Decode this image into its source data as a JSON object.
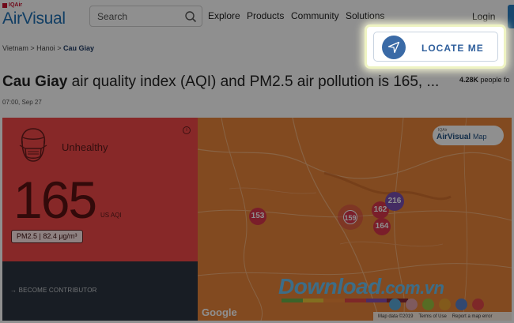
{
  "header": {
    "brand_top": "IQAir",
    "brand_main": "AirVisual",
    "search_placeholder": "Search",
    "nav": [
      "Explore",
      "Products",
      "Community",
      "Solutions"
    ],
    "login_label": "Login"
  },
  "breadcrumb": {
    "items": [
      "Vietnam",
      "Hanoi",
      "Cau Giay"
    ],
    "separator": ">"
  },
  "title": {
    "city": "Cau Giay",
    "rest": " air quality index (AQI) and PM2.5 air pollution is 165, ..."
  },
  "timestamp": "07:00, Sep 27",
  "followers": {
    "count": "4.28K",
    "suffix": " people fo"
  },
  "locate_button": {
    "label": "LOCATE ME",
    "icon": "navigation-arrow-icon"
  },
  "aqi": {
    "status": "Unhealthy",
    "value": "165",
    "unit": "US AQI",
    "pm25": "PM2.5 | 82.4 µg/m³",
    "info": "i"
  },
  "contributor": {
    "label": "BECOME CONTRIBUTOR",
    "arrow": "→"
  },
  "map": {
    "brand_small": "IQAir",
    "brand_name": "AirVisual",
    "brand_suffix": "Map",
    "markers": [
      "153",
      "159",
      "162",
      "216",
      "164"
    ],
    "google": "Google",
    "footer": [
      "Map data ©2019",
      "Terms of Use",
      "Report a map error"
    ],
    "watermark": "Download",
    "watermark_suffix": ".com.vn"
  },
  "colors": {
    "unhealthy": "#f04848",
    "brand": "#1f6fb2",
    "map_bg": "#e8843a",
    "contrib_bg": "#2b3540"
  }
}
